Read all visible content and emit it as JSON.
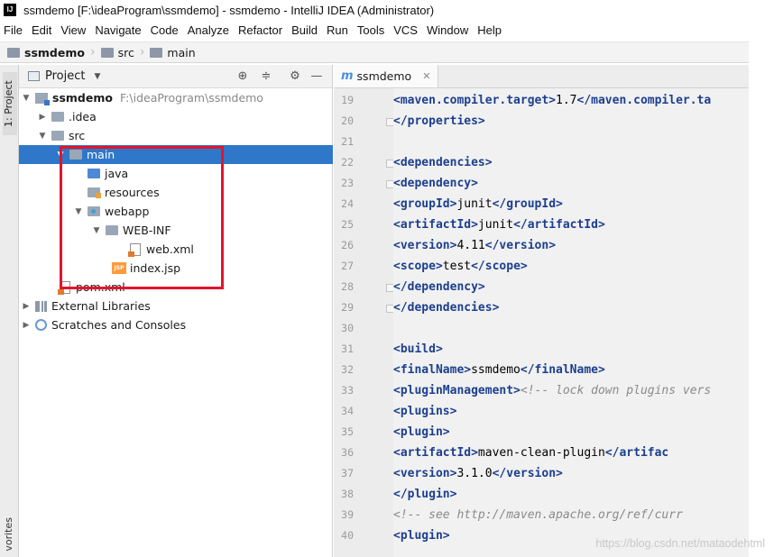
{
  "window": {
    "title": "ssmdemo [F:\\ideaProgram\\ssmdemo] - ssmdemo - IntelliJ IDEA (Administrator)",
    "app_icon": "IJ"
  },
  "menu": [
    "File",
    "Edit",
    "View",
    "Navigate",
    "Code",
    "Analyze",
    "Refactor",
    "Build",
    "Run",
    "Tools",
    "VCS",
    "Window",
    "Help"
  ],
  "breadcrumb": [
    "ssmdemo",
    "src",
    "main"
  ],
  "left_strip": {
    "project_label": "1: Project",
    "favorites_label": "vorites"
  },
  "project_panel": {
    "title": "Project",
    "tree": [
      {
        "label": "ssmdemo",
        "path": "F:\\ideaProgram\\ssmdemo"
      },
      {
        "label": ".idea"
      },
      {
        "label": "src"
      },
      {
        "label": "main"
      },
      {
        "label": "java"
      },
      {
        "label": "resources"
      },
      {
        "label": "webapp"
      },
      {
        "label": "WEB-INF"
      },
      {
        "label": "web.xml"
      },
      {
        "label": "index.jsp"
      },
      {
        "label": "pom.xml"
      },
      {
        "label": "External Libraries"
      },
      {
        "label": "Scratches and Consoles"
      }
    ]
  },
  "editor": {
    "tab_label": "ssmdemo",
    "lines": [
      {
        "n": "19",
        "parts": [
          [
            "tg",
            "    <maven.compiler.target>"
          ],
          [
            "tx",
            "1.7"
          ],
          [
            "tg",
            "</maven.compiler.ta"
          ]
        ]
      },
      {
        "n": "20",
        "parts": [
          [
            "tg",
            "  </properties>"
          ]
        ]
      },
      {
        "n": "21",
        "parts": []
      },
      {
        "n": "22",
        "parts": [
          [
            "tg",
            "  <dependencies>"
          ]
        ]
      },
      {
        "n": "23",
        "parts": [
          [
            "tg",
            "    <dependency>"
          ]
        ]
      },
      {
        "n": "24",
        "parts": [
          [
            "tg",
            "      <groupId>"
          ],
          [
            "tx",
            "junit"
          ],
          [
            "tg",
            "</groupId>"
          ]
        ]
      },
      {
        "n": "25",
        "parts": [
          [
            "tg",
            "      <artifactId>"
          ],
          [
            "tx",
            "junit"
          ],
          [
            "tg",
            "</artifactId>"
          ]
        ]
      },
      {
        "n": "26",
        "parts": [
          [
            "tg",
            "      <version>"
          ],
          [
            "tx",
            "4.11"
          ],
          [
            "tg",
            "</version>"
          ]
        ]
      },
      {
        "n": "27",
        "parts": [
          [
            "tg",
            "      <scope>"
          ],
          [
            "tx",
            "test"
          ],
          [
            "tg",
            "</scope>"
          ]
        ]
      },
      {
        "n": "28",
        "parts": [
          [
            "tg",
            "    </dependency>"
          ]
        ]
      },
      {
        "n": "29",
        "parts": [
          [
            "tg",
            "  </dependencies>"
          ]
        ]
      },
      {
        "n": "30",
        "parts": []
      },
      {
        "n": "31",
        "parts": [
          [
            "tg",
            "  <build>"
          ]
        ]
      },
      {
        "n": "32",
        "parts": [
          [
            "tg",
            "    <finalName>"
          ],
          [
            "tx",
            "ssmdemo"
          ],
          [
            "tg",
            "</finalName>"
          ]
        ]
      },
      {
        "n": "33",
        "parts": [
          [
            "tg",
            "    <pluginManagement>"
          ],
          [
            "cm",
            "<!-- lock down plugins vers"
          ]
        ]
      },
      {
        "n": "34",
        "parts": [
          [
            "tg",
            "      <plugins>"
          ]
        ]
      },
      {
        "n": "35",
        "parts": [
          [
            "tg",
            "        <plugin>"
          ]
        ]
      },
      {
        "n": "36",
        "parts": [
          [
            "tg",
            "          <artifactId>"
          ],
          [
            "tx",
            "maven-clean-plugin"
          ],
          [
            "tg",
            "</artifac"
          ]
        ]
      },
      {
        "n": "37",
        "parts": [
          [
            "tg",
            "          <version>"
          ],
          [
            "tx",
            "3.1.0"
          ],
          [
            "tg",
            "</version>"
          ]
        ]
      },
      {
        "n": "38",
        "parts": [
          [
            "tg",
            "        </plugin>"
          ]
        ]
      },
      {
        "n": "39",
        "parts": [
          [
            "cm",
            "        <!-- see http://maven.apache.org/ref/curr"
          ]
        ]
      },
      {
        "n": "40",
        "parts": [
          [
            "tg",
            "        <plugin>"
          ]
        ]
      }
    ]
  },
  "watermark": "https://blog.csdn.net/mataodehtml",
  "colors": {
    "selection": "#2f77c9",
    "annotation_box": "#e3152b",
    "xml_tag": "#1c3f8f"
  }
}
